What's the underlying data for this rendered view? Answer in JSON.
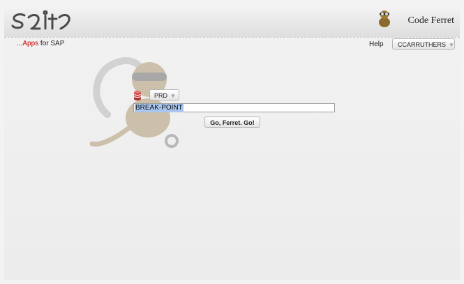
{
  "header": {
    "logo_text": "sait",
    "app_name": "Code Ferret",
    "app_icon": "ferret-icon",
    "tagline_prefix": "...Apps",
    "tagline_suffix": " for SAP",
    "help_label": "Help",
    "user_label": "CCARRUTHERS"
  },
  "search": {
    "environment": "PRD",
    "environment_icon": "database-icon",
    "query": "BREAK-POINT",
    "submit_label": "Go, Ferret. Go!"
  },
  "colors": {
    "tagline_accent": "#cc0000",
    "selection": "#a9c6f0"
  }
}
